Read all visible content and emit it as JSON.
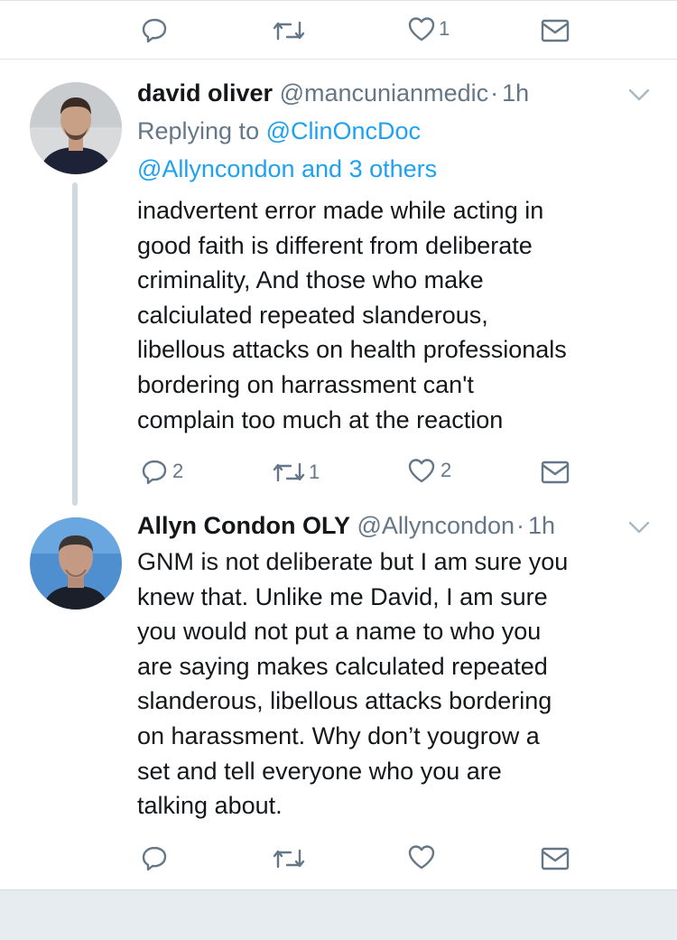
{
  "top_actions": {
    "reply_count": "",
    "retweet_count": "",
    "like_count": "1"
  },
  "tweets": [
    {
      "display_name": "david oliver",
      "handle": "@mancunianmedic",
      "separator": "·",
      "time": "1h",
      "reply_prefix": "Replying to",
      "reply_to_1": "@ClinOncDoc",
      "reply_to_2": "@Allyncondon and 3 others",
      "text": "inadvertent error made while acting in\ngood faith is different from deliberate\ncriminality, And those who make\ncalciulated repeated slanderous,\nlibellous attacks on health professionals\nbordering on harrassment can't\ncomplain too much at the reaction",
      "reply_count": "2",
      "retweet_count": "1",
      "like_count": "2"
    },
    {
      "display_name": "Allyn Condon OLY",
      "handle": "@Allyncondon",
      "separator": "·",
      "time": "1h",
      "text": "GNM is not deliberate but I am sure you\nknew that. Unlike me David, I am sure\nyou would not put a name to who you\nare saying makes calculated repeated\nslanderous, libellous attacks bordering\non harassment. Why don’t yougrow a\nset and tell everyone who you are\ntalking about.",
      "reply_count": "",
      "retweet_count": "",
      "like_count": ""
    }
  ],
  "icons": {
    "reply": "reply-icon",
    "retweet": "retweet-icon",
    "like": "heart-icon",
    "dm": "envelope-icon",
    "caret": "chevron-down-icon"
  },
  "colors": {
    "link": "#1da1f2",
    "secondary": "#657786",
    "text": "#14171a",
    "thread_line": "#cfd9de"
  }
}
